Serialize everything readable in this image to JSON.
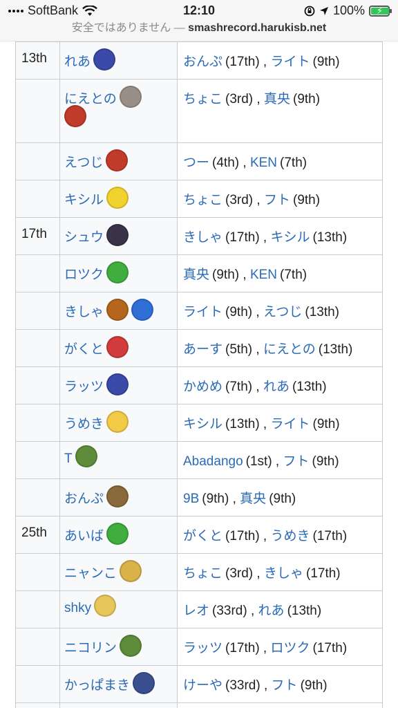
{
  "status": {
    "carrier": "SoftBank",
    "time": "12:10",
    "battery": "100%",
    "battery_level": 1.0
  },
  "url": {
    "warning": "安全ではありません —",
    "domain": "smashrecord.harukisb.net"
  },
  "colors": {
    "link": "#2a6ab6",
    "cell_bg": "#f8f9fa",
    "border": "#c8ccd1",
    "battery_fill": "#33c759"
  },
  "rows": [
    {
      "rank": "13th",
      "player": "れあ",
      "fighters": [
        {
          "icon": "greninja-icon",
          "color": "#3b4aa8"
        }
      ],
      "lost": [
        {
          "name": "おんぷ",
          "place": "(17th)"
        },
        {
          "name": "ライト",
          "place": "(9th)"
        }
      ]
    },
    {
      "rank": "",
      "player": "にえとの",
      "fighters": [
        {
          "icon": "sheik-icon",
          "color": "#9a8f86"
        },
        {
          "icon": "diddy-kong-icon",
          "color": "#c23a2a"
        }
      ],
      "lost": [
        {
          "name": "ちょこ",
          "place": "(3rd)"
        },
        {
          "name": "真央",
          "place": "(9th)"
        }
      ]
    },
    {
      "rank": "",
      "player": "えつじ",
      "fighters": [
        {
          "icon": "diddy-kong-icon",
          "color": "#c23a2a"
        }
      ],
      "lost": [
        {
          "name": "つー",
          "place": "(4th)"
        },
        {
          "name": "KEN",
          "place": "(7th)"
        }
      ]
    },
    {
      "rank": "",
      "player": "キシル",
      "fighters": [
        {
          "icon": "pikachu-icon",
          "color": "#f2d22e"
        }
      ],
      "lost": [
        {
          "name": "ちょこ",
          "place": "(3rd)"
        },
        {
          "name": "フト",
          "place": "(9th)"
        }
      ]
    },
    {
      "rank": "17th",
      "player": "シュウ",
      "fighters": [
        {
          "icon": "bayonetta-icon",
          "color": "#3a3347"
        }
      ],
      "lost": [
        {
          "name": "きしゃ",
          "place": "(17th)"
        },
        {
          "name": "キシル",
          "place": "(13th)"
        }
      ]
    },
    {
      "rank": "",
      "player": "ロツク",
      "fighters": [
        {
          "icon": "yoshi-icon",
          "color": "#3fae3f"
        }
      ],
      "lost": [
        {
          "name": "真央",
          "place": "(9th)"
        },
        {
          "name": "KEN",
          "place": "(7th)"
        }
      ]
    },
    {
      "rank": "",
      "player": "きしゃ",
      "fighters": [
        {
          "icon": "bowser-icon",
          "color": "#b5651d"
        },
        {
          "icon": "mega-man-icon",
          "color": "#2f6fd6"
        }
      ],
      "lost": [
        {
          "name": "ライト",
          "place": "(9th)"
        },
        {
          "name": "えつじ",
          "place": "(13th)"
        }
      ]
    },
    {
      "rank": "",
      "player": "がくと",
      "fighters": [
        {
          "icon": "ness-icon",
          "color": "#d23b3b"
        }
      ],
      "lost": [
        {
          "name": "あーす",
          "place": "(5th)"
        },
        {
          "name": "にえとの",
          "place": "(13th)"
        }
      ]
    },
    {
      "rank": "",
      "player": "ラッツ",
      "fighters": [
        {
          "icon": "greninja-icon",
          "color": "#3b4aa8"
        }
      ],
      "lost": [
        {
          "name": "かめめ",
          "place": "(7th)"
        },
        {
          "name": "れあ",
          "place": "(13th)"
        }
      ]
    },
    {
      "rank": "",
      "player": "うめき",
      "fighters": [
        {
          "icon": "peach-icon",
          "color": "#f3c948"
        }
      ],
      "lost": [
        {
          "name": "キシル",
          "place": "(13th)"
        },
        {
          "name": "ライト",
          "place": "(9th)"
        }
      ]
    },
    {
      "rank": "",
      "player": "T",
      "fighters": [
        {
          "icon": "young-link-icon",
          "color": "#5e8c3a"
        }
      ],
      "lost": [
        {
          "name": "Abadango",
          "place": "(1st)"
        },
        {
          "name": "フト",
          "place": "(9th)"
        }
      ]
    },
    {
      "rank": "",
      "player": "おんぷ",
      "fighters": [
        {
          "icon": "zelda-icon",
          "color": "#8a6a3a"
        }
      ],
      "lost": [
        {
          "name": "9B",
          "place": "(9th)"
        },
        {
          "name": "真央",
          "place": "(9th)"
        }
      ]
    },
    {
      "rank": "25th",
      "player": "あいば",
      "fighters": [
        {
          "icon": "yoshi-icon",
          "color": "#3fae3f"
        }
      ],
      "lost": [
        {
          "name": "がくと",
          "place": "(17th)"
        },
        {
          "name": "うめき",
          "place": "(17th)"
        }
      ]
    },
    {
      "rank": "",
      "player": "ニャンこ",
      "fighters": [
        {
          "icon": "cloud-icon",
          "color": "#d9b24a"
        }
      ],
      "lost": [
        {
          "name": "ちょこ",
          "place": "(3rd)"
        },
        {
          "name": "きしゃ",
          "place": "(17th)"
        }
      ]
    },
    {
      "rank": "",
      "player": "shky",
      "fighters": [
        {
          "icon": "zero-suit-samus-icon",
          "color": "#e7c65a"
        }
      ],
      "lost": [
        {
          "name": "レオ",
          "place": "(33rd)"
        },
        {
          "name": "れあ",
          "place": "(13th)"
        }
      ]
    },
    {
      "rank": "",
      "player": "ニコリン",
      "fighters": [
        {
          "icon": "link-icon",
          "color": "#5e8c3a"
        }
      ],
      "lost": [
        {
          "name": "ラッツ",
          "place": "(17th)"
        },
        {
          "name": "ロツク",
          "place": "(17th)"
        }
      ]
    },
    {
      "rank": "",
      "player": "かっぱまき",
      "fighters": [
        {
          "icon": "meta-knight-icon",
          "color": "#3b4f8f"
        }
      ],
      "lost": [
        {
          "name": "けーや",
          "place": "(33rd)"
        },
        {
          "name": "フト",
          "place": "(9th)"
        }
      ]
    },
    {
      "rank": "",
      "player": "",
      "fighters": [],
      "lost": []
    }
  ]
}
